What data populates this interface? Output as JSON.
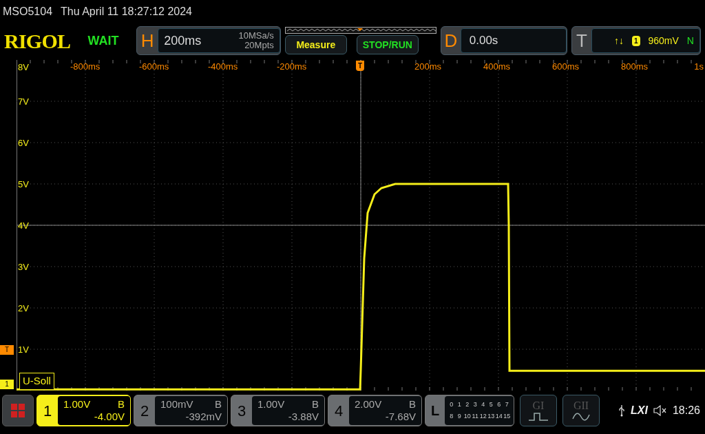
{
  "header": {
    "model": "MSO5104",
    "datetime": "Thu April 11 18:27:12 2024"
  },
  "toolbar": {
    "logo": "RIGOL",
    "status": "WAIT",
    "horizontal": {
      "letter": "H",
      "timebase": "200ms",
      "sample_rate": "10MSa/s",
      "memory": "20Mpts"
    },
    "buttons": [
      {
        "label": "Measure",
        "kind": "measure"
      },
      {
        "label": "STOP/RUN",
        "kind": "run"
      }
    ],
    "delay": {
      "letter": "D",
      "value": "0.00s"
    },
    "trigger": {
      "letter": "T",
      "slope": "↑↓",
      "source": "1",
      "level": "960mV",
      "mode": "N"
    }
  },
  "plot": {
    "chart_data": {
      "type": "line",
      "grid": true,
      "ref_lines": [
        {
          "axis": "x",
          "value": 0
        },
        {
          "axis": "y",
          "value": 4
        }
      ],
      "xlim": [
        -1000,
        1000
      ],
      "ylim": [
        0,
        8
      ],
      "xticks": [
        {
          "value": -800,
          "label": "-800ms"
        },
        {
          "value": -600,
          "label": "-600ms"
        },
        {
          "value": -400,
          "label": "-400ms"
        },
        {
          "value": -200,
          "label": "-200ms"
        },
        {
          "value": 200,
          "label": "200ms"
        },
        {
          "value": 400,
          "label": "400ms"
        },
        {
          "value": 600,
          "label": "600ms"
        },
        {
          "value": 800,
          "label": "800ms"
        }
      ],
      "yticks": [
        {
          "value": 7,
          "label": "7V"
        },
        {
          "value": 6,
          "label": "6V"
        },
        {
          "value": 5,
          "label": "5V"
        },
        {
          "value": 4,
          "label": "4V"
        },
        {
          "value": 3,
          "label": "3V"
        },
        {
          "value": 2,
          "label": "2V"
        },
        {
          "value": 1,
          "label": "1V"
        }
      ],
      "x": [
        -1000,
        -2,
        0,
        10,
        20,
        40,
        60,
        100,
        428,
        430,
        432,
        1000
      ],
      "series": [
        {
          "name": "U-Soll",
          "color": "#f5ee1a",
          "values": [
            0.03,
            0.03,
            0.5,
            3.2,
            4.3,
            4.75,
            4.9,
            5.0,
            5.0,
            4.0,
            0.48,
            0.48
          ]
        }
      ]
    },
    "x_end_label": "1s",
    "y_top_label": "8V",
    "trigger_position_marker": "T",
    "trigger_level_marker": "T",
    "channel_marker": "1"
  },
  "channels": [
    {
      "number": "1",
      "scale": "1.00V",
      "coupling": "B",
      "offset": "-4.00V",
      "selected": true
    },
    {
      "number": "2",
      "scale": "100mV",
      "coupling": "B",
      "offset": "-392mV",
      "selected": false
    },
    {
      "number": "3",
      "scale": "1.00V",
      "coupling": "B",
      "offset": "-3.88V",
      "selected": false
    },
    {
      "number": "4",
      "scale": "2.00V",
      "coupling": "B",
      "offset": "-7.68V",
      "selected": false
    }
  ],
  "logic": {
    "letter": "L",
    "bits": [
      "0",
      "1",
      "2",
      "3",
      "4",
      "5",
      "6",
      "7",
      "8",
      "9",
      "10",
      "11",
      "12",
      "13",
      "14",
      "15"
    ]
  },
  "generators": [
    {
      "label": "GI",
      "kind": "pulse"
    },
    {
      "label": "GII",
      "kind": "sine"
    }
  ],
  "status": {
    "lxi": "LXI",
    "time": "18:26"
  }
}
